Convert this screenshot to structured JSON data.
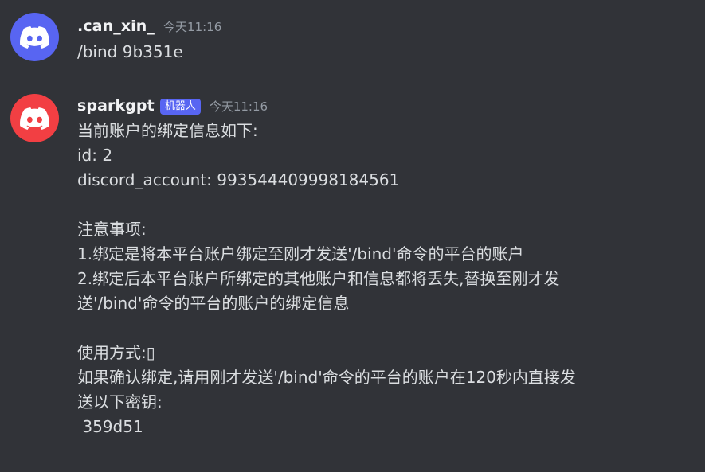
{
  "messages": [
    {
      "username": ".can_xin_",
      "timestamp": "今天11:16",
      "content": "/bind 9b351e",
      "avatar_icon": "discord-logo-icon",
      "avatar_color": "#5865f2"
    },
    {
      "username": "sparkgpt",
      "bot_tag": "机器人",
      "timestamp": "今天11:16",
      "content": "当前账户的绑定信息如下:\nid: 2\ndiscord_account: 993544409998184561\n\n注意事项:\n1.绑定是将本平台账户绑定至刚才发送'/bind'命令的平台的账户\n2.绑定后本平台账户所绑定的其他账户和信息都将丢失,替换至刚才发\n送'/bind'命令的平台的账户的绑定信息\n\n使用方式:▯\n如果确认绑定,请用刚才发送'/bind'命令的平台的账户在120秒内直接发\n送以下密钥:\n 359d51",
      "avatar_icon": "discord-logo-icon",
      "avatar_color": "#f23f43",
      "bot_tag_color": "#5865f2"
    }
  ]
}
